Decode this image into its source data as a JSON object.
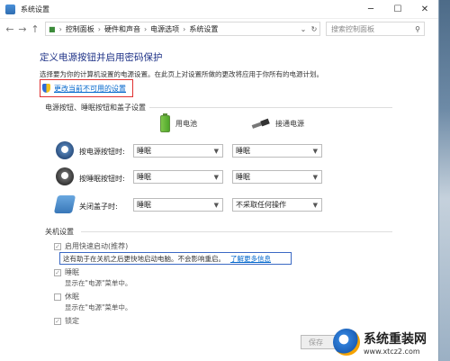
{
  "window": {
    "title": "系统设置",
    "controls": [
      "─",
      "☐",
      "✕"
    ]
  },
  "address": {
    "back": "←",
    "forward": "→",
    "up": "↑",
    "breadcrumb": [
      "控制面板",
      "硬件和声音",
      "电源选项",
      "系统设置"
    ],
    "dropdown": "⌄",
    "refresh": "↻",
    "search_placeholder": "搜索控制面板"
  },
  "page": {
    "heading": "定义电源按钮并启用密码保护",
    "description": "选择要为你的计算机设置的电源设置。在此页上对设置所做的更改将应用于你所有的电源计划。",
    "change_link": "更改当前不可用的设置",
    "section_buttons": "电源按钮、睡眠按钮和盖子设置",
    "col_battery": "用电池",
    "col_plugged": "接通电源",
    "rows": [
      {
        "label": "按电源按钮时:",
        "battery": "睡眠",
        "plugged": "睡眠"
      },
      {
        "label": "按睡眠按钮时:",
        "battery": "睡眠",
        "plugged": "睡眠"
      },
      {
        "label": "关闭盖子时:",
        "battery": "睡眠",
        "plugged": "不采取任何操作"
      }
    ],
    "section_shutdown": "关机设置",
    "fast_startup": "启用快速启动(推荐)",
    "fast_startup_help": "这有助于在关机之后更快地启动电脑。不会影响重启。",
    "learn_more": "了解更多信息",
    "sleep_label": "睡眠",
    "sleep_desc": "显示在\"电源\"菜单中。",
    "hibernate_label": "休眠",
    "hibernate_desc": "显示在\"电源\"菜单中。",
    "lock_label": "锁定",
    "save_button": "保存"
  },
  "watermark": {
    "title": "系统重装网",
    "url": "www.xtcz2.com"
  }
}
